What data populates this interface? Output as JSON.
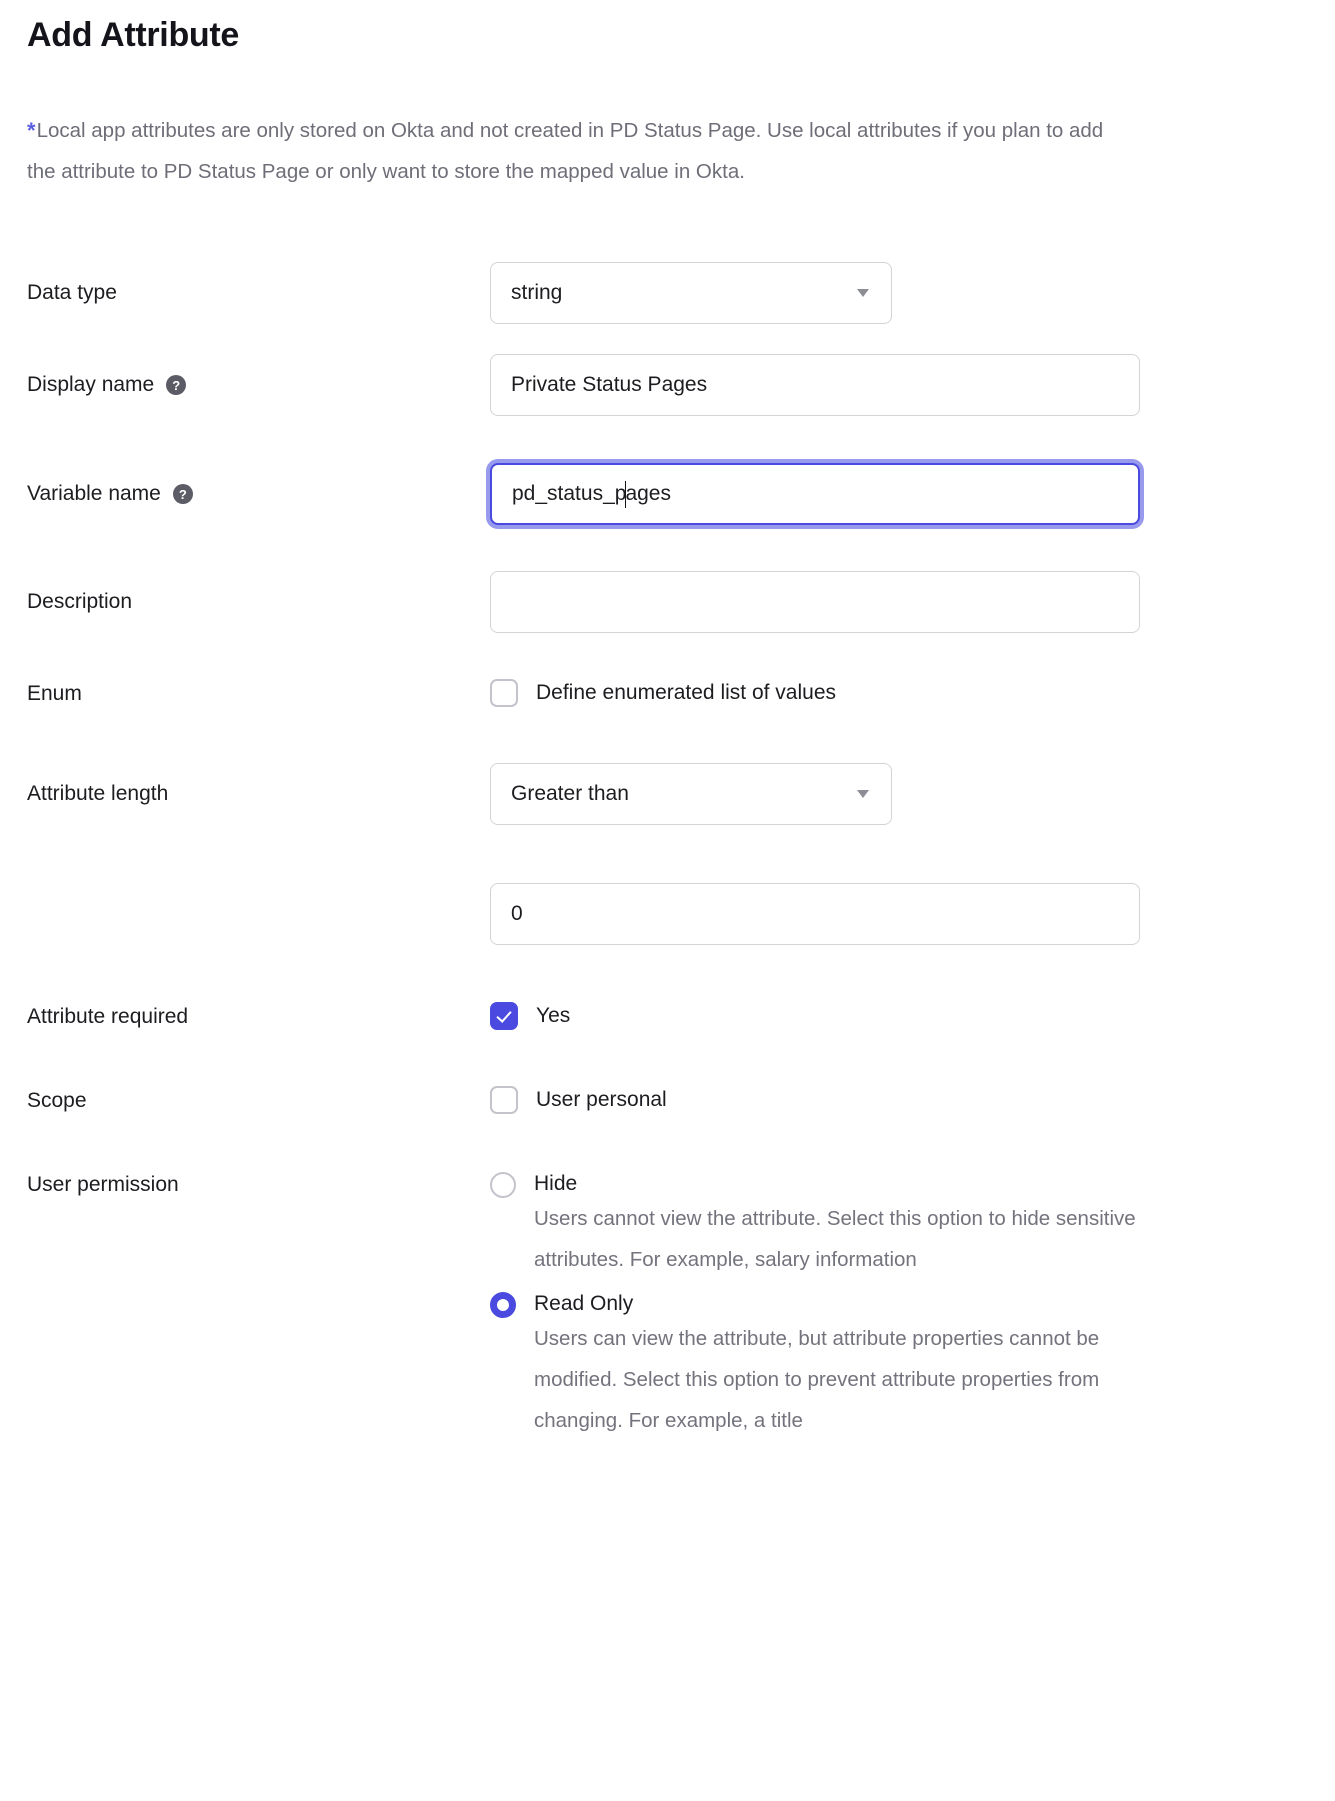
{
  "page_title": "Add Attribute",
  "note": {
    "asterisk": "*",
    "text": "Local app attributes are only stored on Okta and not created in PD Status Page. Use local attributes if you plan to add the attribute to PD Status Page or only want to store the mapped value in Okta."
  },
  "help_icon_glyph": "?",
  "fields": {
    "data_type": {
      "label": "Data type",
      "value": "string",
      "icon": "chevron-down-icon"
    },
    "display_name": {
      "label": "Display name",
      "value": "Private Status Pages",
      "help": "?"
    },
    "variable_name": {
      "label": "Variable name",
      "value_before_cursor": "pd_status_p",
      "value_after_cursor": "ages",
      "value": "pd_status_pages",
      "help": "?",
      "focused": true
    },
    "description": {
      "label": "Description",
      "value": "",
      "placeholder": ""
    },
    "enum": {
      "label": "Enum",
      "checkbox_label": "Define enumerated list of values",
      "checked": false
    },
    "attribute_length": {
      "label": "Attribute length",
      "value": "Greater than",
      "icon": "chevron-down-icon",
      "number_value": "0"
    },
    "attribute_required": {
      "label": "Attribute required",
      "checkbox_label": "Yes",
      "checked": true
    },
    "scope": {
      "label": "Scope",
      "checkbox_label": "User personal",
      "checked": false
    },
    "user_permission": {
      "label": "User permission",
      "options": [
        {
          "label": "Hide",
          "selected": false,
          "description": "Users cannot view the attribute. Select this option to hide sensitive attributes. For example, salary information"
        },
        {
          "label": "Read Only",
          "selected": true,
          "description": "Users can view the attribute, but attribute properties cannot be modified. Select this option to prevent attribute properties from changing. For example, a title"
        }
      ]
    }
  },
  "colors": {
    "accent": "#4a4ae0",
    "focus_glow": "#7a7ee8",
    "text": "#1d1d21",
    "muted_text": "#73737d",
    "border": "#d4d4d8"
  }
}
